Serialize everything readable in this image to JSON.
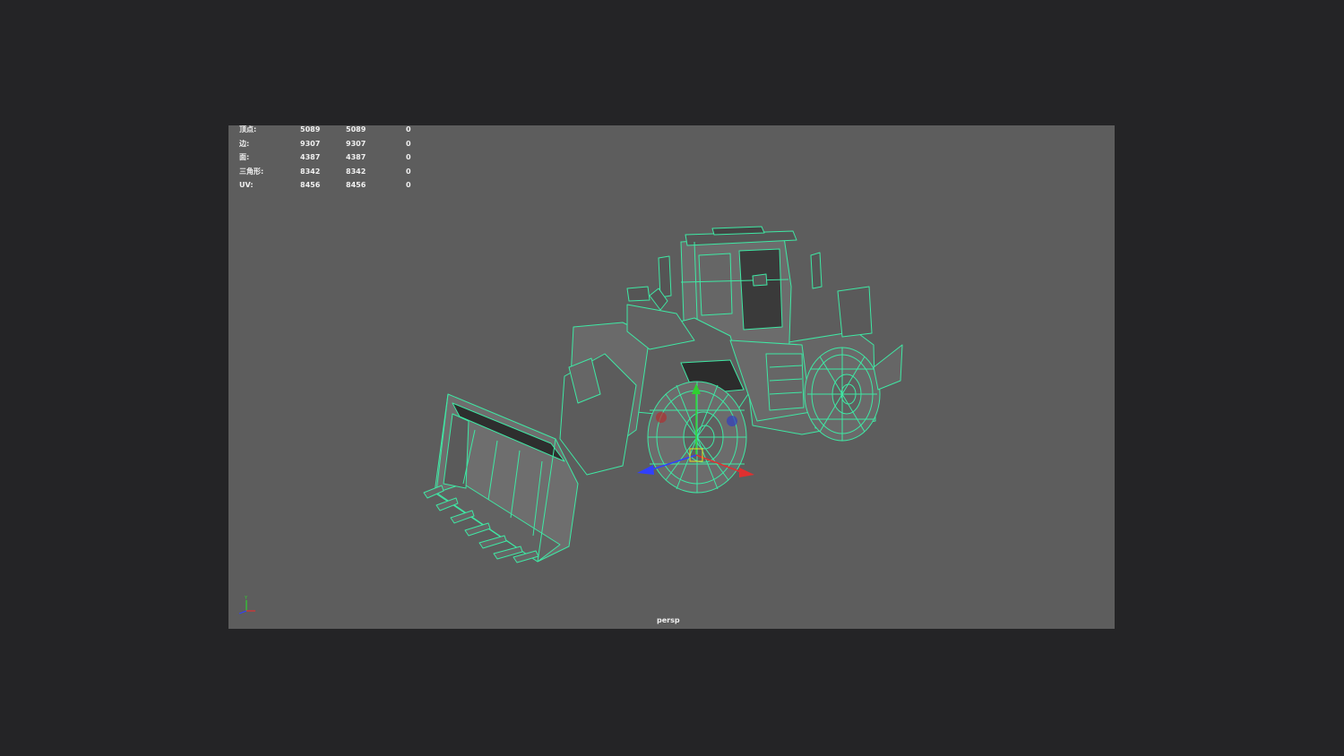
{
  "viewport": {
    "camera": "persp",
    "heads_up_display": {
      "rows": [
        {
          "label": "顶点:",
          "values": [
            "5089",
            "5089",
            "0"
          ]
        },
        {
          "label": "边:",
          "values": [
            "9307",
            "9307",
            "0"
          ]
        },
        {
          "label": "面:",
          "values": [
            "4387",
            "4387",
            "0"
          ]
        },
        {
          "label": "三角形:",
          "values": [
            "8342",
            "8342",
            "0"
          ]
        },
        {
          "label": "UV:",
          "values": [
            "8456",
            "8456",
            "0"
          ]
        }
      ]
    },
    "axis_indicator": {
      "y_label": "Y",
      "colors": {
        "x": "#e03030",
        "y": "#30d030",
        "z": "#3040ff"
      }
    },
    "model": {
      "icon": "wheel-loader-wireframe",
      "wire_color": "#3fe8a4",
      "fill_color": "#6a6a6a",
      "dark_fill_color": "#2c2c2c"
    },
    "manipulator": {
      "icon": "move-manipulator"
    }
  },
  "colors": {
    "background": "#242426",
    "viewport": "#5d5d5d",
    "hud_text": "#f0f0f0"
  }
}
